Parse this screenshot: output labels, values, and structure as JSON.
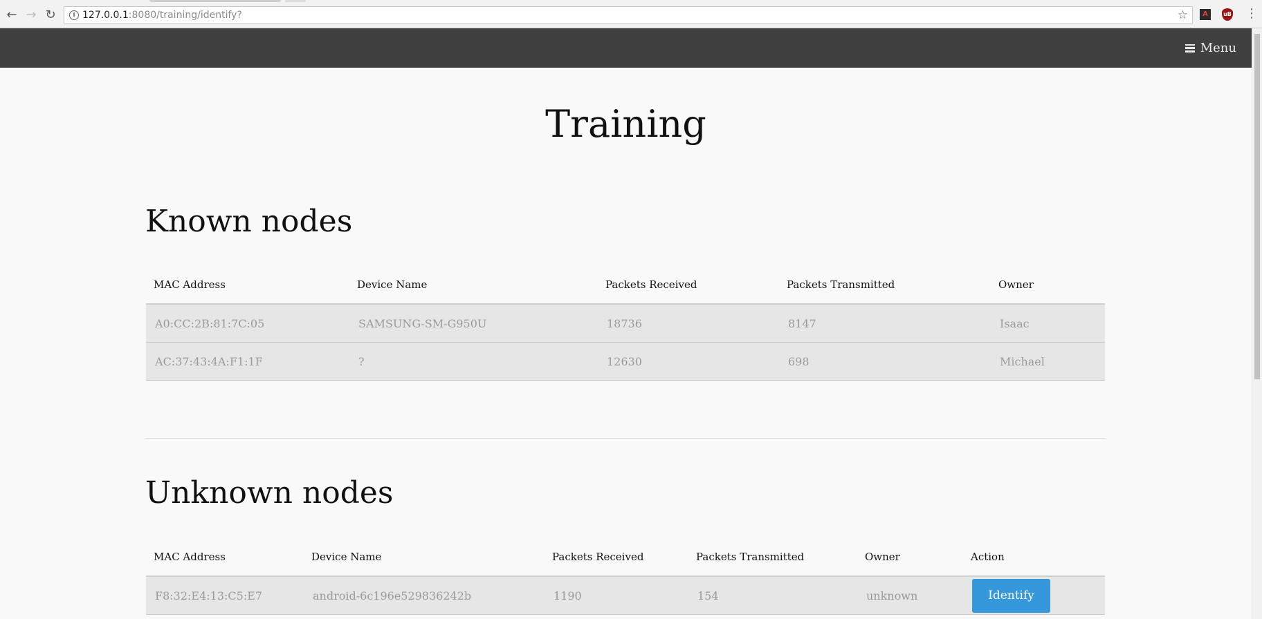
{
  "browser": {
    "url_host": "127.0.0.1",
    "url_path": ":8080/training/identify?"
  },
  "nav": {
    "menu_label": "Menu"
  },
  "page": {
    "title": "Training"
  },
  "known": {
    "title": "Known nodes",
    "columns": [
      "MAC Address",
      "Device Name",
      "Packets Received",
      "Packets Transmitted",
      "Owner"
    ],
    "rows": [
      {
        "mac": "A0:CC:2B:81:7C:05",
        "device": "SAMSUNG-SM-G950U",
        "received": "18736",
        "transmitted": "8147",
        "owner": "Isaac"
      },
      {
        "mac": "AC:37:43:4A:F1:1F",
        "device": "?",
        "received": "12630",
        "transmitted": "698",
        "owner": "Michael"
      }
    ]
  },
  "unknown": {
    "title": "Unknown nodes",
    "columns": [
      "MAC Address",
      "Device Name",
      "Packets Received",
      "Packets Transmitted",
      "Owner",
      "Action"
    ],
    "rows": [
      {
        "mac": "F8:32:E4:13:C5:E7",
        "device": "android-6c196e529836242b",
        "received": "1190",
        "transmitted": "154",
        "owner": "unknown",
        "action": "Identify"
      }
    ]
  },
  "colors": {
    "navbar": "#404040",
    "accent": "#3498db",
    "row_bg": "#e6e6e6"
  }
}
